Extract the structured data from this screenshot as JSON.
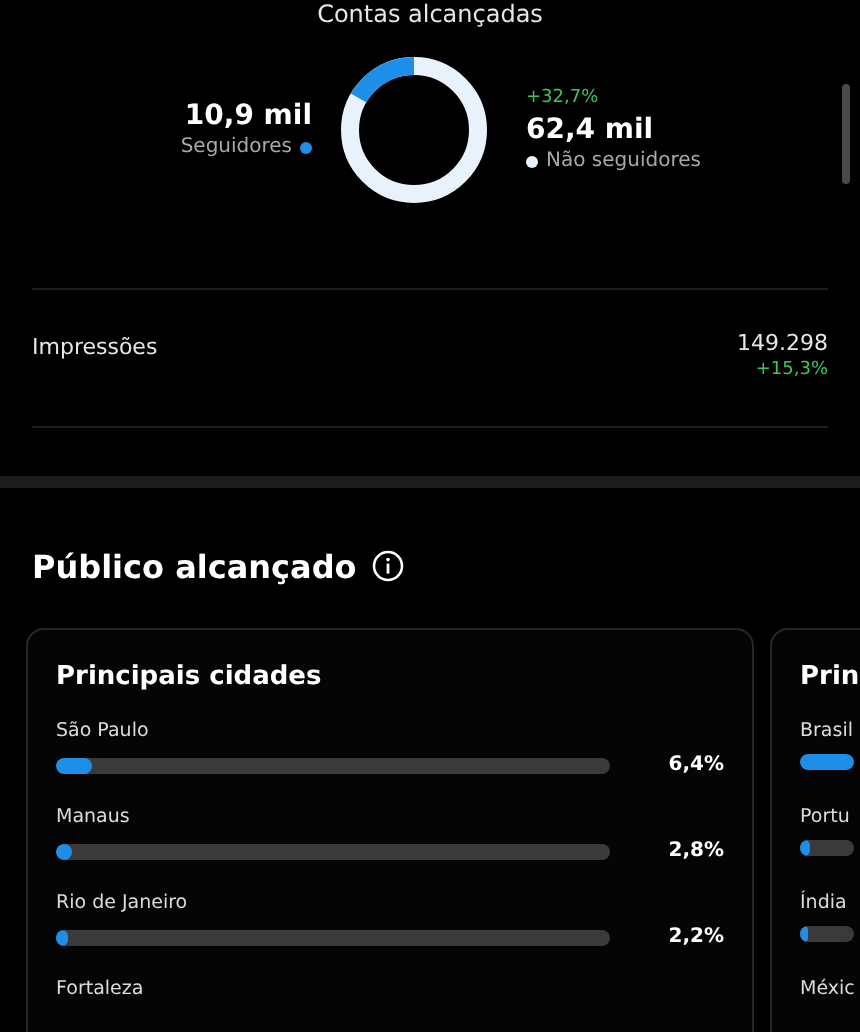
{
  "reach": {
    "title": "Contas alcançadas",
    "followers": {
      "value": "10,9 mil",
      "label": "Seguidores",
      "color": "#1d8fe8"
    },
    "non_followers": {
      "change": "+32,7%",
      "value": "62,4 mil",
      "label": "Não seguidores",
      "color": "#e8f2fc"
    }
  },
  "impressions": {
    "label": "Impressões",
    "value": "149.298",
    "change": "+15,3%"
  },
  "audience": {
    "title": "Público alcançado",
    "cards": [
      {
        "title": "Principais cidades",
        "rows": [
          {
            "label": "São Paulo",
            "level": 0.064,
            "reading": "6,4%"
          },
          {
            "label": "Manaus",
            "level": 0.028,
            "reading": "2,8%"
          },
          {
            "label": "Rio de Janeiro",
            "level": 0.022,
            "reading": "2,2%"
          },
          {
            "label": "Fortaleza"
          }
        ]
      },
      {
        "title": "Prin",
        "rows": [
          {
            "label": "Brasil",
            "level": 1
          },
          {
            "label": "Portu",
            "level": 0.2
          },
          {
            "label": "Índia",
            "level": 0.1
          },
          {
            "label": "Méxic"
          }
        ]
      }
    ]
  }
}
